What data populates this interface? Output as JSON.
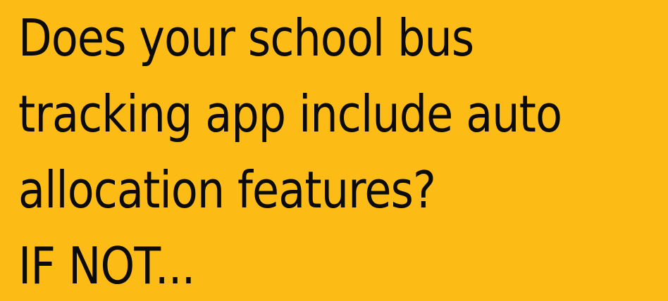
{
  "colors": {
    "background": "#FDBB16",
    "text": "#0B0B0B"
  },
  "headline": {
    "lines": [
      "Does your school bus",
      "tracking app include auto",
      "allocation features?",
      "IF NOT..."
    ]
  }
}
